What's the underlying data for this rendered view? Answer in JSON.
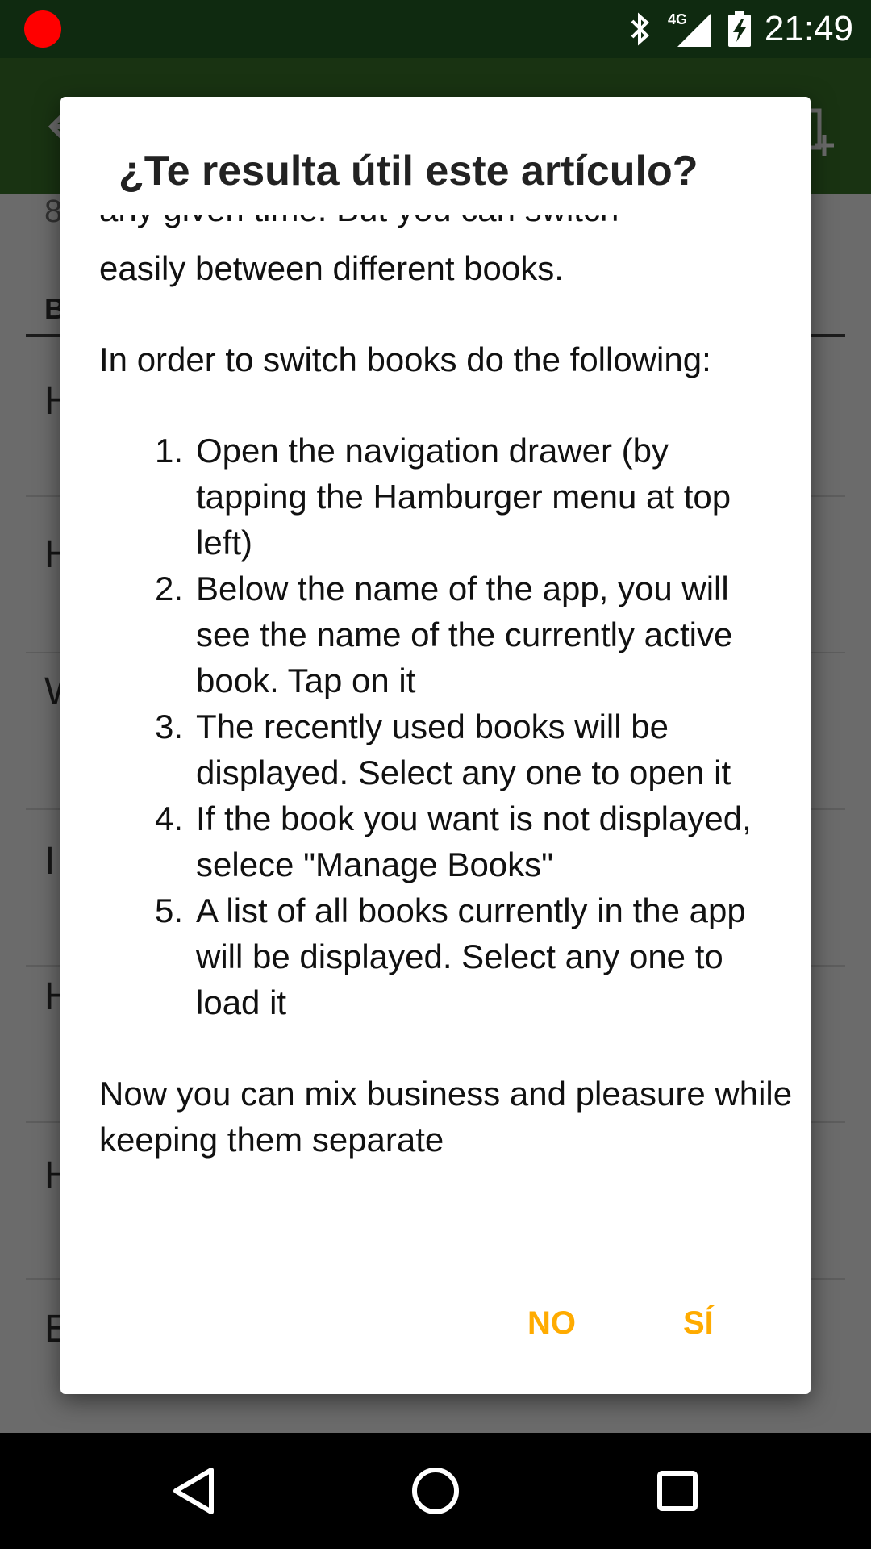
{
  "status_bar": {
    "time": "21:49",
    "network_label": "4G",
    "icons": [
      "record-dot-icon",
      "bluetooth-icon",
      "signal-icon",
      "battery-charging-icon"
    ]
  },
  "app_bar": {
    "icons": [
      "back-arrow-icon",
      "add-book-icon"
    ]
  },
  "background": {
    "count_text": "8",
    "section_initial": "B",
    "row_initials": [
      "H",
      "H",
      "W",
      "I",
      "H",
      "H",
      "E"
    ]
  },
  "dialog": {
    "title": "¿Te resulta útil este artículo?",
    "partial_top_line": "any given time. But you can switch",
    "body_line_1": "easily between different books.",
    "intro": "In order to switch books do the following:",
    "steps": [
      {
        "num": "1.",
        "text": "Open the navigation drawer (by tapping the Hamburger menu at top left)"
      },
      {
        "num": "2.",
        "text": "Below the name of the app, you will see the name of the currently active book. Tap on it"
      },
      {
        "num": "3.",
        "text": "The recently used books will be displayed. Select any one to open it"
      },
      {
        "num": "4.",
        "text": "If the book you want is not displayed, selece \"Manage Books\""
      },
      {
        "num": "5.",
        "text": "A list of all books currently in the app will be displayed. Select any one to load it"
      }
    ],
    "closing": "Now you can mix business and pleasure while keeping them separate",
    "button_no": "NO",
    "button_yes": "SÍ"
  },
  "colors": {
    "status_bar": "#0f2a10",
    "app_bar": "#3d7a2c",
    "accent": "#ffab00",
    "record": "#ff0000"
  }
}
